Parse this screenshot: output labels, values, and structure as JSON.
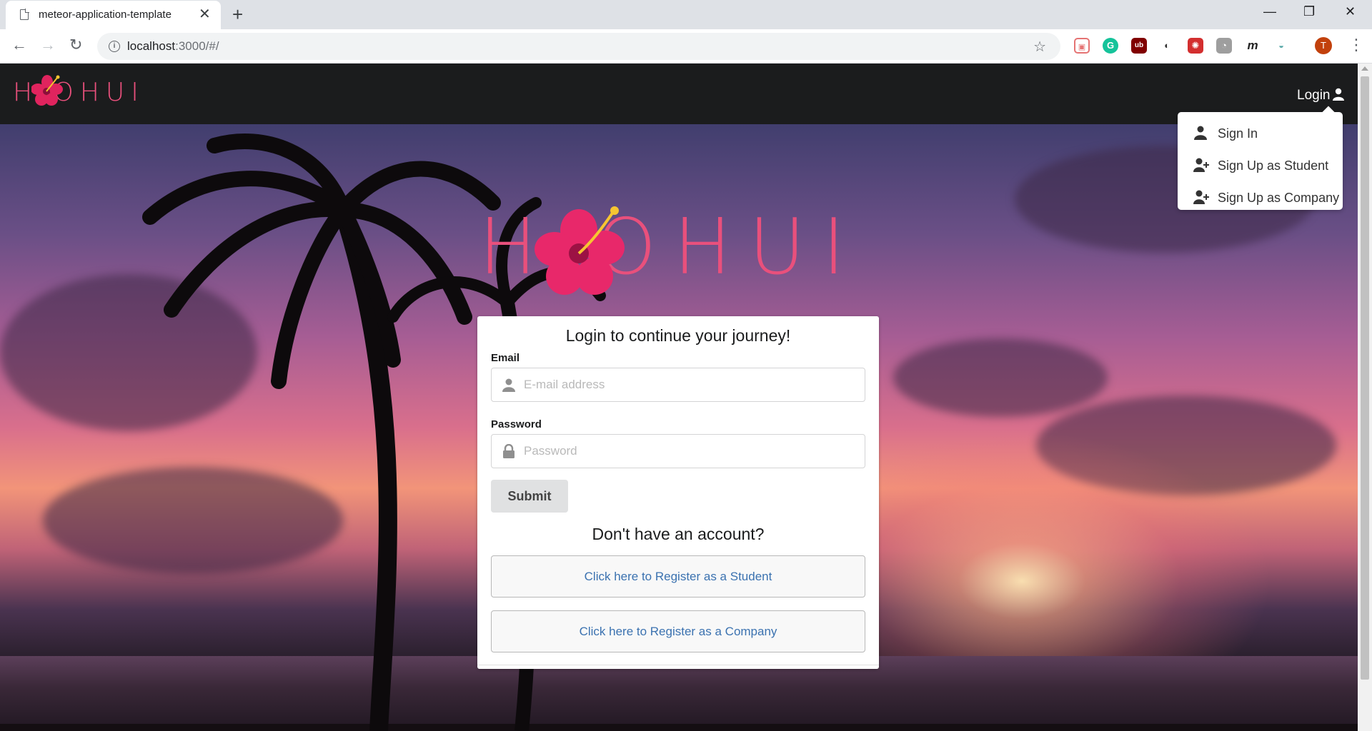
{
  "browser": {
    "tab_title": "meteor-application-template",
    "tab_close": "✕",
    "new_tab": "+",
    "url_host": "localhost",
    "url_rest": ":3000/#/",
    "avatar_letter": "T",
    "window_controls": [
      "—",
      "❐",
      "✕"
    ]
  },
  "navbar": {
    "brand": "H OHUI",
    "login_label": "Login",
    "dropdown": [
      {
        "label": "Sign In",
        "icon": "user-icon"
      },
      {
        "label": "Sign Up as Student",
        "icon": "user-plus-icon"
      },
      {
        "label": "Sign Up as Company",
        "icon": "user-plus-icon"
      }
    ]
  },
  "hero": {
    "logo": "H OHUI"
  },
  "login_card": {
    "title": "Login to continue your journey!",
    "email_label": "Email",
    "email_placeholder": "E-mail address",
    "password_label": "Password",
    "password_placeholder": "Password",
    "submit_label": "Submit",
    "no_account": "Don't have an account?",
    "register_student": "Click here to Register as a Student",
    "register_company": "Click here to Register as a Company"
  },
  "colors": {
    "brand_pink": "#e9507c",
    "navbar_bg": "#1b1c1d",
    "link_blue": "#3b72b0"
  }
}
